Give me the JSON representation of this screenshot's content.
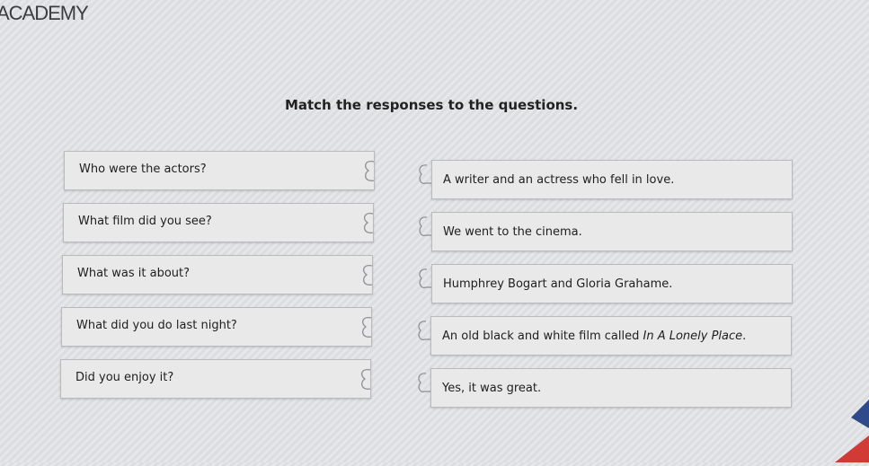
{
  "brand": "ACADEMY",
  "instructions": "Match the responses to the questions.",
  "questions": [
    "Who were the actors?",
    "What film did you see?",
    "What was it about?",
    "What did you do last night?",
    "Did you enjoy it?"
  ],
  "answers": [
    {
      "text": "A writer and an actress who fell in love."
    },
    {
      "text": "We went to the cinema."
    },
    {
      "text": "Humphrey Bogart and Gloria Grahame."
    },
    {
      "text": "An old black and white film called ",
      "title": "In A Lonely Place",
      "suffix": "."
    },
    {
      "text": "Yes, it was great."
    }
  ],
  "colors": {
    "background": "#e0e1e4",
    "card": "#e9e9ea",
    "border": "#b9babd",
    "accent_red": "#d23b35",
    "accent_blue": "#2f4a8a"
  },
  "icons": {
    "question_connector": "puzzle-knob-icon",
    "answer_connector": "puzzle-socket-icon"
  }
}
